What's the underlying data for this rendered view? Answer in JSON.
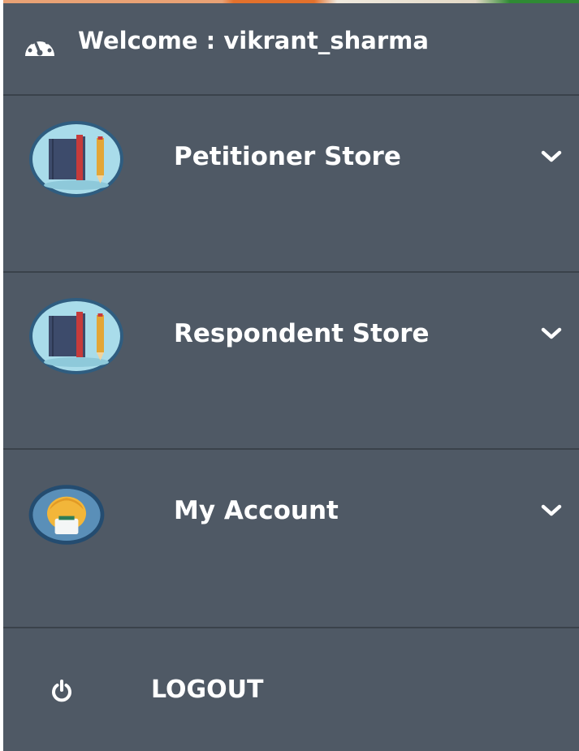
{
  "header": {
    "welcome_text": "Welcome : vikrant_sharma",
    "icon": "dashboard-gauge-icon"
  },
  "menu": {
    "items": [
      {
        "label": "Petitioner Store",
        "icon": "books-pencil-icon",
        "expand_icon": "chevron-down-icon"
      },
      {
        "label": "Respondent Store",
        "icon": "books-pencil-icon",
        "expand_icon": "chevron-down-icon"
      },
      {
        "label": "My Account",
        "icon": "user-avatar-icon",
        "expand_icon": "chevron-down-icon"
      }
    ]
  },
  "logout": {
    "label": "LOGOUT",
    "icon": "power-icon"
  },
  "colors": {
    "panel_background": "#4f5965",
    "divider": "#3a424b",
    "text": "#ffffff",
    "avatar_fill": "#a9dcea"
  }
}
